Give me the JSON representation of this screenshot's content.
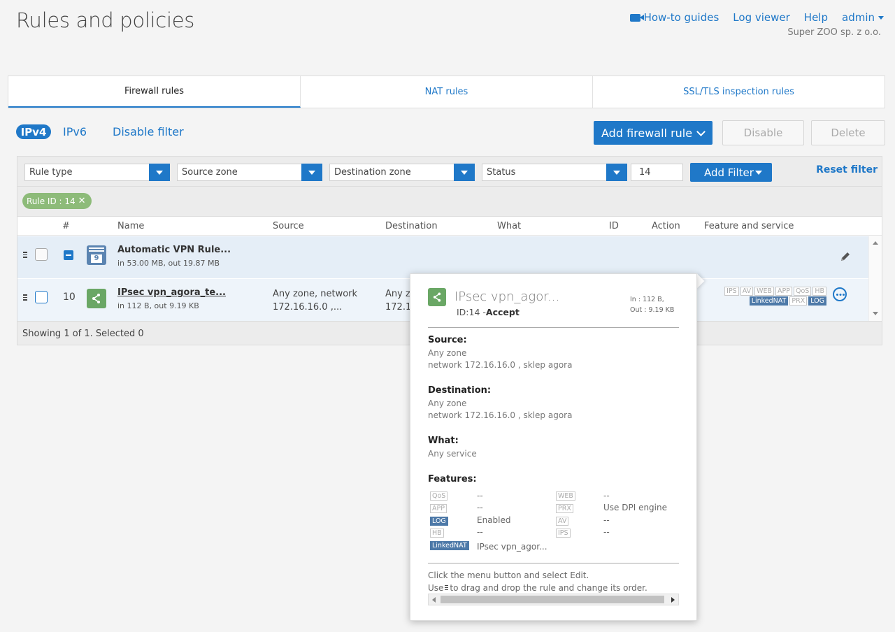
{
  "header": {
    "title": "Rules and policies",
    "nav": {
      "howto": "How-to guides",
      "log_viewer": "Log viewer",
      "help": "Help",
      "user": "admin"
    },
    "company": "Super ZOO sp. z o.o."
  },
  "tabs": [
    {
      "label": "Firewall rules",
      "active": true
    },
    {
      "label": "NAT rules",
      "active": false
    },
    {
      "label": "SSL/TLS inspection rules",
      "active": false
    }
  ],
  "toolbar": {
    "ipv4": "IPv4",
    "ipv6": "IPv6",
    "disable_filter": "Disable filter",
    "add_rule": "Add firewall rule",
    "disable": "Disable",
    "delete": "Delete"
  },
  "filters": {
    "rule_type": "Rule type",
    "source_zone": "Source zone",
    "destination_zone": "Destination zone",
    "status": "Status",
    "id_value": "14",
    "add_filter": "Add Filter",
    "reset_filter": "Reset filter",
    "chip": "Rule ID : 14"
  },
  "table": {
    "columns": [
      "#",
      "Name",
      "Source",
      "Destination",
      "What",
      "ID",
      "Action",
      "Feature and service"
    ],
    "group_row": {
      "icon_number": "9",
      "name": "Automatic VPN Rule...",
      "traffic": "in 53.00 MB, out 19.87 MB"
    },
    "rule_row": {
      "number": "10",
      "name": "IPsec vpn_agora_te...",
      "traffic": "in 112 B, out 9.19 KB",
      "source_line1": "Any zone, network",
      "source_line2": "172.16.16.0 ,...",
      "destination_line1": "Any z",
      "destination_line2": "172.1",
      "features_row1": [
        "IPS",
        "AV",
        "WEB",
        "APP",
        "QoS",
        "HB"
      ],
      "features_row2": [
        "LinkedNAT",
        "PRX",
        "LOG"
      ]
    },
    "footer": "Showing 1 of 1. Selected 0"
  },
  "popover": {
    "title": "IPsec vpn_agor...",
    "id_label": "ID:14 -",
    "action": "Accept",
    "in": "In : 112 B,",
    "out": "Out : 9.19 KB",
    "source_label": "Source:",
    "source_line1": "Any zone",
    "source_line2": "network 172.16.16.0 , sklep agora",
    "destination_label": "Destination:",
    "destination_line1": "Any zone",
    "destination_line2": "network 172.16.16.0 , sklep agora",
    "what_label": "What:",
    "what_value": "Any service",
    "features_label": "Features:",
    "features": {
      "qos": {
        "tag": "QoS",
        "value": "--"
      },
      "app": {
        "tag": "APP",
        "value": "--"
      },
      "log": {
        "tag": "LOG",
        "value": "Enabled"
      },
      "hb": {
        "tag": "HB",
        "value": "--"
      },
      "linkednat": {
        "tag": "LinkedNAT",
        "value": "IPsec vpn_agor..."
      },
      "web": {
        "tag": "WEB",
        "value": "--"
      },
      "prx": {
        "tag": "PRX",
        "value": "Use DPI engine"
      },
      "av": {
        "tag": "AV",
        "value": "--"
      },
      "ips": {
        "tag": "IPS",
        "value": "--"
      }
    },
    "help_line1": "Click the menu button and select Edit.",
    "help_use": "Use",
    "help_line2_rest": "to drag and drop the rule and change its order."
  },
  "colors": {
    "accent": "#1f78c8",
    "rule_icon": "#6aa765",
    "group_icon": "#5b84b1",
    "chip": "#8dbb79"
  }
}
